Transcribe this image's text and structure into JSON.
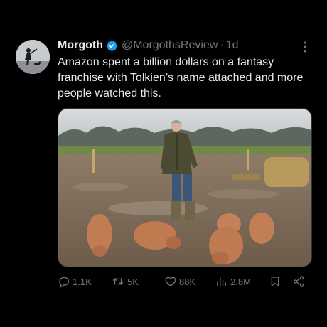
{
  "tweet": {
    "author_name": "Morgoth",
    "handle": "@MorgothsReview",
    "separator": "·",
    "time": "1d",
    "text": "Amazon spent a billion dollars on a fantasy franchise with Tolkien’s name attached and more people watched this."
  },
  "actions": {
    "replies": "1.1K",
    "reposts": "5K",
    "likes": "88K",
    "views": "2.8M"
  },
  "colors": {
    "background": "#000000",
    "text": "#e7e9ea",
    "secondary": "#71767b",
    "verified": "#1d9bf0"
  }
}
